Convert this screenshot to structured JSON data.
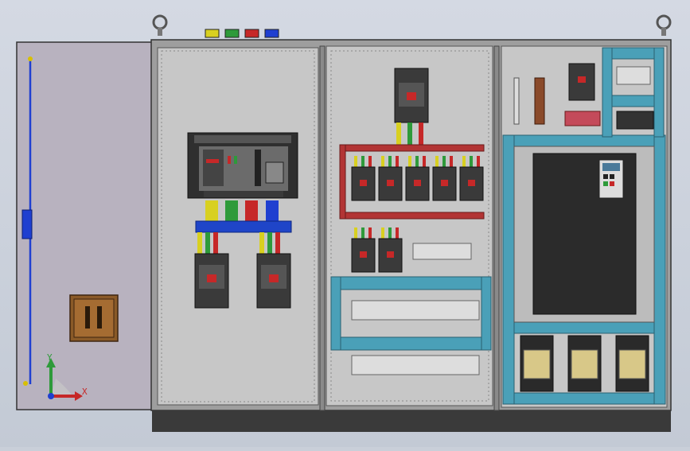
{
  "scene": {
    "kind": "cad-3d-viewport",
    "colors": {
      "background": "#c9cfd9",
      "panel": "#c7c7c7",
      "door": "#b8b2bf",
      "busbar_red": "#b23434",
      "busbar_blue": "#1f45c8",
      "din_rail": "#4aa0b8",
      "plinth": "#3a3a3a",
      "phase_yellow": "#d8d020",
      "phase_green": "#2e9a3a",
      "phase_red": "#c62828",
      "phase_blue": "#1f3fd0"
    },
    "phase_markers": [
      {
        "color": "#d8d020"
      },
      {
        "color": "#2e9a3a"
      },
      {
        "color": "#c62828"
      },
      {
        "color": "#1f3fd0"
      }
    ],
    "icons": [
      "lifting-eye-icon",
      "door-handle-icon",
      "acb-breaker-icon",
      "mccb-breaker-icon",
      "vfd-keypad-icon",
      "contactor-icon",
      "terminal-block-icon",
      "triad-axis-icon"
    ],
    "triad": {
      "x_label": "X",
      "y_label": "Y"
    }
  }
}
